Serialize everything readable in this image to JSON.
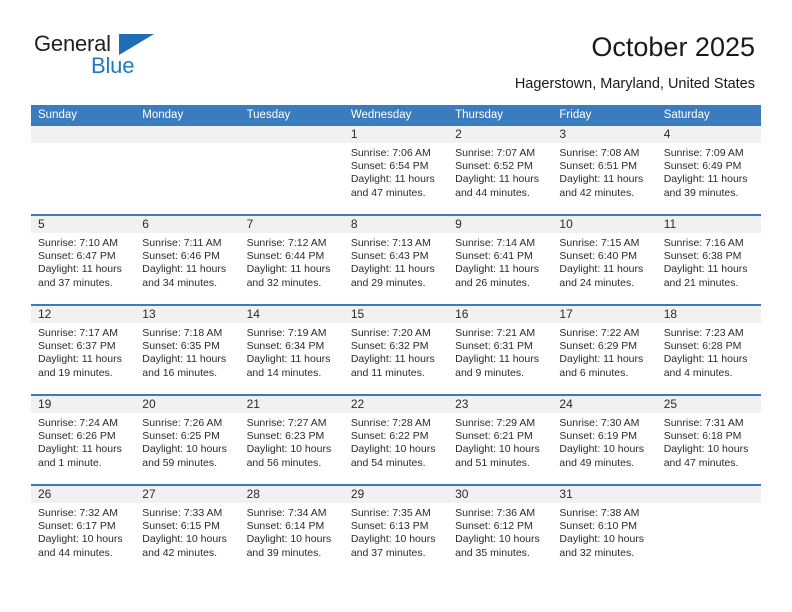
{
  "brand": {
    "name_top": "General",
    "name_bottom": "Blue",
    "triangle_color": "#1f6eb5",
    "blue_text_color": "#1f7ac4"
  },
  "header": {
    "title": "October 2025",
    "subtitle": "Hagerstown, Maryland, United States"
  },
  "theme": {
    "header_bg": "#3a7cbe",
    "header_text": "#ffffff",
    "daynum_band_bg": "#f1f1f1",
    "row_divider": "#3a7cbe",
    "body_text": "#2b2b2b"
  },
  "calendar": {
    "weekday_headers": [
      "Sunday",
      "Monday",
      "Tuesday",
      "Wednesday",
      "Thursday",
      "Friday",
      "Saturday"
    ],
    "weeks": [
      [
        {
          "day": "",
          "blank": true
        },
        {
          "day": "",
          "blank": true
        },
        {
          "day": "",
          "blank": true
        },
        {
          "day": "1",
          "sunrise": "Sunrise: 7:06 AM",
          "sunset": "Sunset: 6:54 PM",
          "daylight": "Daylight: 11 hours and 47 minutes."
        },
        {
          "day": "2",
          "sunrise": "Sunrise: 7:07 AM",
          "sunset": "Sunset: 6:52 PM",
          "daylight": "Daylight: 11 hours and 44 minutes."
        },
        {
          "day": "3",
          "sunrise": "Sunrise: 7:08 AM",
          "sunset": "Sunset: 6:51 PM",
          "daylight": "Daylight: 11 hours and 42 minutes."
        },
        {
          "day": "4",
          "sunrise": "Sunrise: 7:09 AM",
          "sunset": "Sunset: 6:49 PM",
          "daylight": "Daylight: 11 hours and 39 minutes."
        }
      ],
      [
        {
          "day": "5",
          "sunrise": "Sunrise: 7:10 AM",
          "sunset": "Sunset: 6:47 PM",
          "daylight": "Daylight: 11 hours and 37 minutes."
        },
        {
          "day": "6",
          "sunrise": "Sunrise: 7:11 AM",
          "sunset": "Sunset: 6:46 PM",
          "daylight": "Daylight: 11 hours and 34 minutes."
        },
        {
          "day": "7",
          "sunrise": "Sunrise: 7:12 AM",
          "sunset": "Sunset: 6:44 PM",
          "daylight": "Daylight: 11 hours and 32 minutes."
        },
        {
          "day": "8",
          "sunrise": "Sunrise: 7:13 AM",
          "sunset": "Sunset: 6:43 PM",
          "daylight": "Daylight: 11 hours and 29 minutes."
        },
        {
          "day": "9",
          "sunrise": "Sunrise: 7:14 AM",
          "sunset": "Sunset: 6:41 PM",
          "daylight": "Daylight: 11 hours and 26 minutes."
        },
        {
          "day": "10",
          "sunrise": "Sunrise: 7:15 AM",
          "sunset": "Sunset: 6:40 PM",
          "daylight": "Daylight: 11 hours and 24 minutes."
        },
        {
          "day": "11",
          "sunrise": "Sunrise: 7:16 AM",
          "sunset": "Sunset: 6:38 PM",
          "daylight": "Daylight: 11 hours and 21 minutes."
        }
      ],
      [
        {
          "day": "12",
          "sunrise": "Sunrise: 7:17 AM",
          "sunset": "Sunset: 6:37 PM",
          "daylight": "Daylight: 11 hours and 19 minutes."
        },
        {
          "day": "13",
          "sunrise": "Sunrise: 7:18 AM",
          "sunset": "Sunset: 6:35 PM",
          "daylight": "Daylight: 11 hours and 16 minutes."
        },
        {
          "day": "14",
          "sunrise": "Sunrise: 7:19 AM",
          "sunset": "Sunset: 6:34 PM",
          "daylight": "Daylight: 11 hours and 14 minutes."
        },
        {
          "day": "15",
          "sunrise": "Sunrise: 7:20 AM",
          "sunset": "Sunset: 6:32 PM",
          "daylight": "Daylight: 11 hours and 11 minutes."
        },
        {
          "day": "16",
          "sunrise": "Sunrise: 7:21 AM",
          "sunset": "Sunset: 6:31 PM",
          "daylight": "Daylight: 11 hours and 9 minutes."
        },
        {
          "day": "17",
          "sunrise": "Sunrise: 7:22 AM",
          "sunset": "Sunset: 6:29 PM",
          "daylight": "Daylight: 11 hours and 6 minutes."
        },
        {
          "day": "18",
          "sunrise": "Sunrise: 7:23 AM",
          "sunset": "Sunset: 6:28 PM",
          "daylight": "Daylight: 11 hours and 4 minutes."
        }
      ],
      [
        {
          "day": "19",
          "sunrise": "Sunrise: 7:24 AM",
          "sunset": "Sunset: 6:26 PM",
          "daylight": "Daylight: 11 hours and 1 minute."
        },
        {
          "day": "20",
          "sunrise": "Sunrise: 7:26 AM",
          "sunset": "Sunset: 6:25 PM",
          "daylight": "Daylight: 10 hours and 59 minutes."
        },
        {
          "day": "21",
          "sunrise": "Sunrise: 7:27 AM",
          "sunset": "Sunset: 6:23 PM",
          "daylight": "Daylight: 10 hours and 56 minutes."
        },
        {
          "day": "22",
          "sunrise": "Sunrise: 7:28 AM",
          "sunset": "Sunset: 6:22 PM",
          "daylight": "Daylight: 10 hours and 54 minutes."
        },
        {
          "day": "23",
          "sunrise": "Sunrise: 7:29 AM",
          "sunset": "Sunset: 6:21 PM",
          "daylight": "Daylight: 10 hours and 51 minutes."
        },
        {
          "day": "24",
          "sunrise": "Sunrise: 7:30 AM",
          "sunset": "Sunset: 6:19 PM",
          "daylight": "Daylight: 10 hours and 49 minutes."
        },
        {
          "day": "25",
          "sunrise": "Sunrise: 7:31 AM",
          "sunset": "Sunset: 6:18 PM",
          "daylight": "Daylight: 10 hours and 47 minutes."
        }
      ],
      [
        {
          "day": "26",
          "sunrise": "Sunrise: 7:32 AM",
          "sunset": "Sunset: 6:17 PM",
          "daylight": "Daylight: 10 hours and 44 minutes."
        },
        {
          "day": "27",
          "sunrise": "Sunrise: 7:33 AM",
          "sunset": "Sunset: 6:15 PM",
          "daylight": "Daylight: 10 hours and 42 minutes."
        },
        {
          "day": "28",
          "sunrise": "Sunrise: 7:34 AM",
          "sunset": "Sunset: 6:14 PM",
          "daylight": "Daylight: 10 hours and 39 minutes."
        },
        {
          "day": "29",
          "sunrise": "Sunrise: 7:35 AM",
          "sunset": "Sunset: 6:13 PM",
          "daylight": "Daylight: 10 hours and 37 minutes."
        },
        {
          "day": "30",
          "sunrise": "Sunrise: 7:36 AM",
          "sunset": "Sunset: 6:12 PM",
          "daylight": "Daylight: 10 hours and 35 minutes."
        },
        {
          "day": "31",
          "sunrise": "Sunrise: 7:38 AM",
          "sunset": "Sunset: 6:10 PM",
          "daylight": "Daylight: 10 hours and 32 minutes."
        },
        {
          "day": "",
          "blank": true
        }
      ]
    ]
  }
}
